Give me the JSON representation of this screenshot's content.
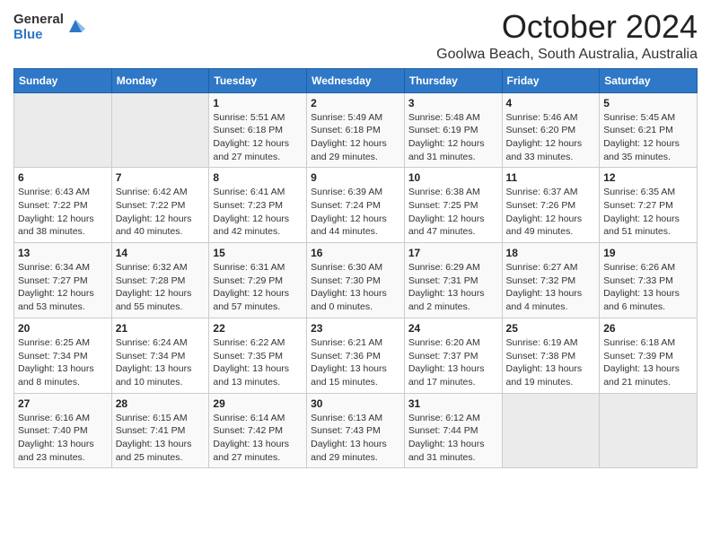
{
  "header": {
    "logo_general": "General",
    "logo_blue": "Blue",
    "title": "October 2024",
    "subtitle": "Goolwa Beach, South Australia, Australia"
  },
  "days_of_week": [
    "Sunday",
    "Monday",
    "Tuesday",
    "Wednesday",
    "Thursday",
    "Friday",
    "Saturday"
  ],
  "weeks": [
    [
      {
        "day": "",
        "detail": ""
      },
      {
        "day": "",
        "detail": ""
      },
      {
        "day": "1",
        "detail": "Sunrise: 5:51 AM\nSunset: 6:18 PM\nDaylight: 12 hours\nand 27 minutes."
      },
      {
        "day": "2",
        "detail": "Sunrise: 5:49 AM\nSunset: 6:18 PM\nDaylight: 12 hours\nand 29 minutes."
      },
      {
        "day": "3",
        "detail": "Sunrise: 5:48 AM\nSunset: 6:19 PM\nDaylight: 12 hours\nand 31 minutes."
      },
      {
        "day": "4",
        "detail": "Sunrise: 5:46 AM\nSunset: 6:20 PM\nDaylight: 12 hours\nand 33 minutes."
      },
      {
        "day": "5",
        "detail": "Sunrise: 5:45 AM\nSunset: 6:21 PM\nDaylight: 12 hours\nand 35 minutes."
      }
    ],
    [
      {
        "day": "6",
        "detail": "Sunrise: 6:43 AM\nSunset: 7:22 PM\nDaylight: 12 hours\nand 38 minutes."
      },
      {
        "day": "7",
        "detail": "Sunrise: 6:42 AM\nSunset: 7:22 PM\nDaylight: 12 hours\nand 40 minutes."
      },
      {
        "day": "8",
        "detail": "Sunrise: 6:41 AM\nSunset: 7:23 PM\nDaylight: 12 hours\nand 42 minutes."
      },
      {
        "day": "9",
        "detail": "Sunrise: 6:39 AM\nSunset: 7:24 PM\nDaylight: 12 hours\nand 44 minutes."
      },
      {
        "day": "10",
        "detail": "Sunrise: 6:38 AM\nSunset: 7:25 PM\nDaylight: 12 hours\nand 47 minutes."
      },
      {
        "day": "11",
        "detail": "Sunrise: 6:37 AM\nSunset: 7:26 PM\nDaylight: 12 hours\nand 49 minutes."
      },
      {
        "day": "12",
        "detail": "Sunrise: 6:35 AM\nSunset: 7:27 PM\nDaylight: 12 hours\nand 51 minutes."
      }
    ],
    [
      {
        "day": "13",
        "detail": "Sunrise: 6:34 AM\nSunset: 7:27 PM\nDaylight: 12 hours\nand 53 minutes."
      },
      {
        "day": "14",
        "detail": "Sunrise: 6:32 AM\nSunset: 7:28 PM\nDaylight: 12 hours\nand 55 minutes."
      },
      {
        "day": "15",
        "detail": "Sunrise: 6:31 AM\nSunset: 7:29 PM\nDaylight: 12 hours\nand 57 minutes."
      },
      {
        "day": "16",
        "detail": "Sunrise: 6:30 AM\nSunset: 7:30 PM\nDaylight: 13 hours\nand 0 minutes."
      },
      {
        "day": "17",
        "detail": "Sunrise: 6:29 AM\nSunset: 7:31 PM\nDaylight: 13 hours\nand 2 minutes."
      },
      {
        "day": "18",
        "detail": "Sunrise: 6:27 AM\nSunset: 7:32 PM\nDaylight: 13 hours\nand 4 minutes."
      },
      {
        "day": "19",
        "detail": "Sunrise: 6:26 AM\nSunset: 7:33 PM\nDaylight: 13 hours\nand 6 minutes."
      }
    ],
    [
      {
        "day": "20",
        "detail": "Sunrise: 6:25 AM\nSunset: 7:34 PM\nDaylight: 13 hours\nand 8 minutes."
      },
      {
        "day": "21",
        "detail": "Sunrise: 6:24 AM\nSunset: 7:34 PM\nDaylight: 13 hours\nand 10 minutes."
      },
      {
        "day": "22",
        "detail": "Sunrise: 6:22 AM\nSunset: 7:35 PM\nDaylight: 13 hours\nand 13 minutes."
      },
      {
        "day": "23",
        "detail": "Sunrise: 6:21 AM\nSunset: 7:36 PM\nDaylight: 13 hours\nand 15 minutes."
      },
      {
        "day": "24",
        "detail": "Sunrise: 6:20 AM\nSunset: 7:37 PM\nDaylight: 13 hours\nand 17 minutes."
      },
      {
        "day": "25",
        "detail": "Sunrise: 6:19 AM\nSunset: 7:38 PM\nDaylight: 13 hours\nand 19 minutes."
      },
      {
        "day": "26",
        "detail": "Sunrise: 6:18 AM\nSunset: 7:39 PM\nDaylight: 13 hours\nand 21 minutes."
      }
    ],
    [
      {
        "day": "27",
        "detail": "Sunrise: 6:16 AM\nSunset: 7:40 PM\nDaylight: 13 hours\nand 23 minutes."
      },
      {
        "day": "28",
        "detail": "Sunrise: 6:15 AM\nSunset: 7:41 PM\nDaylight: 13 hours\nand 25 minutes."
      },
      {
        "day": "29",
        "detail": "Sunrise: 6:14 AM\nSunset: 7:42 PM\nDaylight: 13 hours\nand 27 minutes."
      },
      {
        "day": "30",
        "detail": "Sunrise: 6:13 AM\nSunset: 7:43 PM\nDaylight: 13 hours\nand 29 minutes."
      },
      {
        "day": "31",
        "detail": "Sunrise: 6:12 AM\nSunset: 7:44 PM\nDaylight: 13 hours\nand 31 minutes."
      },
      {
        "day": "",
        "detail": ""
      },
      {
        "day": "",
        "detail": ""
      }
    ]
  ]
}
